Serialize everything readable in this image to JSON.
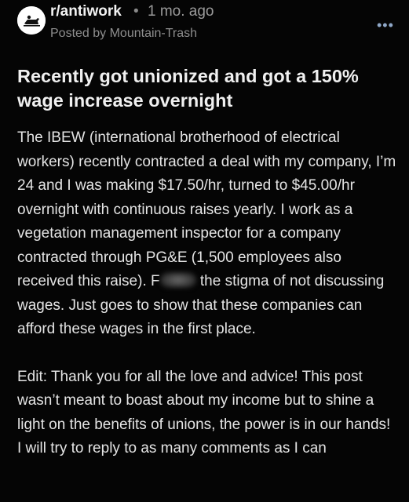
{
  "post": {
    "subreddit": "r/antiwork",
    "separator": "•",
    "time_ago": "1 mo. ago",
    "byline": "Posted by Mountain-Trash",
    "more_icon": "more-dots-icon",
    "more_glyph": "•••",
    "title": "Recently got unionized and got a 150% wage increase overnight",
    "body_part1": "The IBEW (international brotherhood of electrical workers) recently contracted a deal with my company, I’m 24 and I was making $17.50/hr, turned to $45.00/hr overnight with continuous raises yearly. I work as a vegetation management inspector for a company contracted through PG&E (1,500 employees also received this raise). F",
    "body_part2": " the stigma of not discussing wages. Just goes to show that these companies can afford these wages in the first place.",
    "edit": "Edit: Thank you for all the love and advice! This post wasn’t meant to boast about my income but to shine a light on the benefits of unions, the power is in our hands! I will try to reply to as many comments as I can"
  },
  "colors": {
    "background": "#050505",
    "text": "#e4e4e4",
    "muted": "#8e8e8e",
    "more_icon": "#8fa8c8"
  }
}
